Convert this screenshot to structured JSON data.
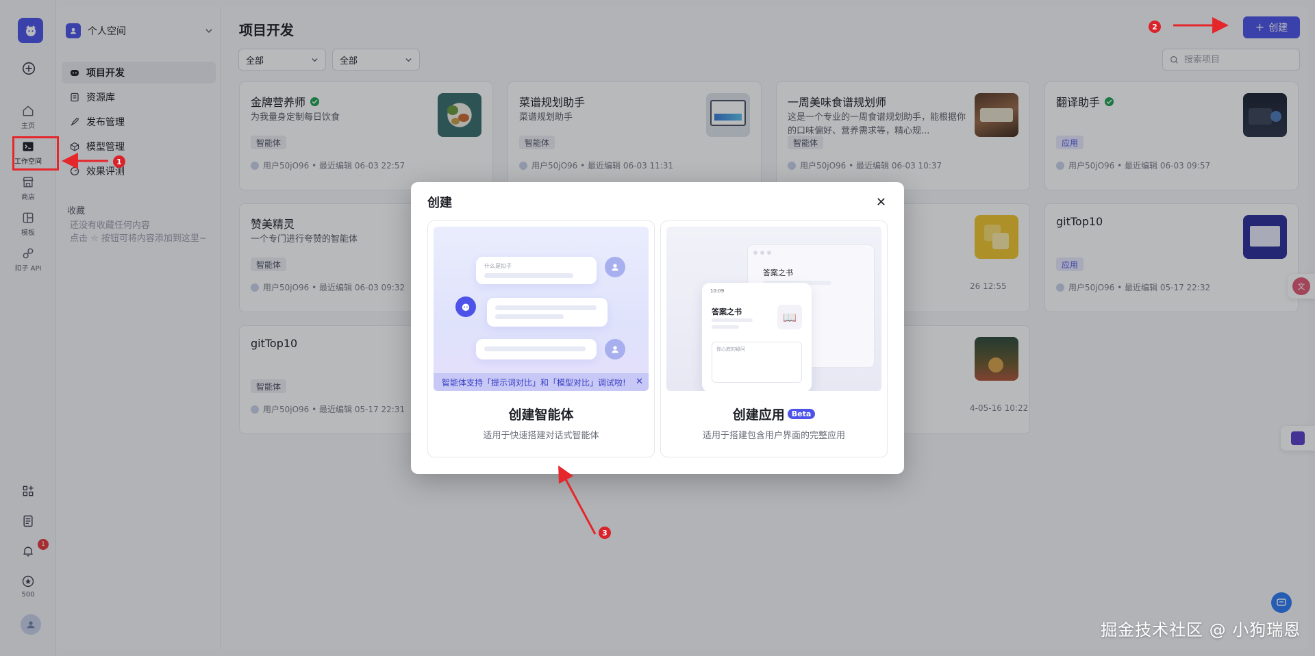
{
  "rail": {
    "items": [
      {
        "label": "主页",
        "icon": "home-icon"
      },
      {
        "label": "工作空间",
        "icon": "terminal-icon"
      },
      {
        "label": "商店",
        "icon": "store-icon"
      },
      {
        "label": "模板",
        "icon": "template-icon"
      },
      {
        "label": "扣子 API",
        "icon": "api-icon"
      }
    ],
    "bottom": {
      "notification_count": "1",
      "points": "500"
    }
  },
  "sidebar": {
    "space_name": "个人空间",
    "nav": [
      "项目开发",
      "资源库",
      "发布管理",
      "模型管理",
      "效果评测"
    ],
    "favorites_title": "收藏",
    "favorites_empty_line1": "还没有收藏任何内容",
    "favorites_empty_line2": "点击 ☆ 按钮可将内容添加到这里~"
  },
  "main": {
    "title": "项目开发",
    "create_label": "创建",
    "filter1": "全部",
    "filter2": "全部",
    "search_placeholder": "搜索项目",
    "cards": [
      {
        "title": "金牌营养师",
        "desc": "为我量身定制每日饮食",
        "tag": "智能体",
        "meta": "用户50jO96 • 最近编辑 06-03 22:57"
      },
      {
        "title": "菜谱规划助手",
        "desc": "菜谱规划助手",
        "tag": "智能体",
        "meta": "用户50jO96 • 最近编辑 06-03 11:31"
      },
      {
        "title": "一周美味食谱规划师",
        "desc": "这是一个专业的一周食谱规划助手，能根据你的口味偏好、营养需求等，精心规...",
        "tag": "智能体",
        "meta": "用户50jO96 • 最近编辑 06-03 10:37"
      },
      {
        "title": "翻译助手",
        "desc": "",
        "tag": "应用",
        "meta": "用户50jO96 • 最近编辑 06-03 09:57"
      },
      {
        "title": "赞美精灵",
        "desc": "一个专门进行夸赞的智能体",
        "tag": "智能体",
        "meta": "用户50jO96 • 最近编辑 06-03 09:32"
      },
      {
        "title": "",
        "desc": "",
        "tag": "",
        "meta": "26 12:55"
      },
      {
        "title": "gitTop10",
        "desc": "",
        "tag": "应用",
        "meta": "用户50jO96 • 最近编辑 05-17 22:32"
      },
      {
        "title": "gitTop10",
        "desc": "",
        "tag": "智能体",
        "meta": "用户50jO96 • 最近编辑 05-17 22:31"
      },
      {
        "title": "",
        "desc": "",
        "tag": "",
        "meta": "4-05-16 10:22"
      }
    ]
  },
  "modal": {
    "title": "创建",
    "agent": {
      "name": "创建智能体",
      "desc": "适用于快速搭建对话式智能体",
      "bubble_text": "什么是扣子",
      "banner": "智能体支持「提示词对比」和「模型对比」调试啦!"
    },
    "app": {
      "name": "创建应用",
      "badge": "Beta",
      "desc": "适用于搭建包含用户界面的完整应用",
      "window_title": "答案之书",
      "phone_time": "10:09",
      "phone_title": "答案之书",
      "phone_input": "你心底的疑问"
    }
  },
  "annotations": {
    "n1": "1",
    "n2": "2",
    "n3": "3"
  },
  "watermark": "掘金技术社区 @ 小狗瑞恩",
  "colors": {
    "accent": "#4d53e8",
    "annotation": "#e5262b",
    "verified": "#1fa254"
  }
}
